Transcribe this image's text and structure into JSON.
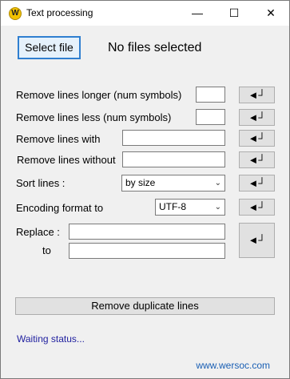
{
  "window": {
    "title": "Text processing",
    "app_icon_letter": "W",
    "controls": {
      "minimize": "—",
      "maximize": "☐",
      "close": "✕"
    }
  },
  "file": {
    "select_label": "Select file",
    "status_label": "No files selected"
  },
  "rows": {
    "longer": {
      "label": "Remove lines longer (num symbols)",
      "value": ""
    },
    "less": {
      "label": "Remove lines less (num symbols)",
      "value": ""
    },
    "with": {
      "label": "Remove lines with",
      "value": ""
    },
    "without": {
      "label": "Remove lines without",
      "value": ""
    },
    "sort": {
      "label": "Sort lines :",
      "selected": "by size"
    },
    "encoding": {
      "label": "Encoding format to",
      "selected": "UTF-8"
    },
    "replace": {
      "label": "Replace :",
      "to_label": "to",
      "from_value": "",
      "to_value": ""
    }
  },
  "apply_glyph": "◄┘",
  "duplicate_label": "Remove duplicate lines",
  "status_text": "Waiting status...",
  "link_text": "www.wersoc.com",
  "colors": {
    "accent": "#2f7fd0",
    "status": "#1f1f9f",
    "link": "#1a5fb4"
  }
}
